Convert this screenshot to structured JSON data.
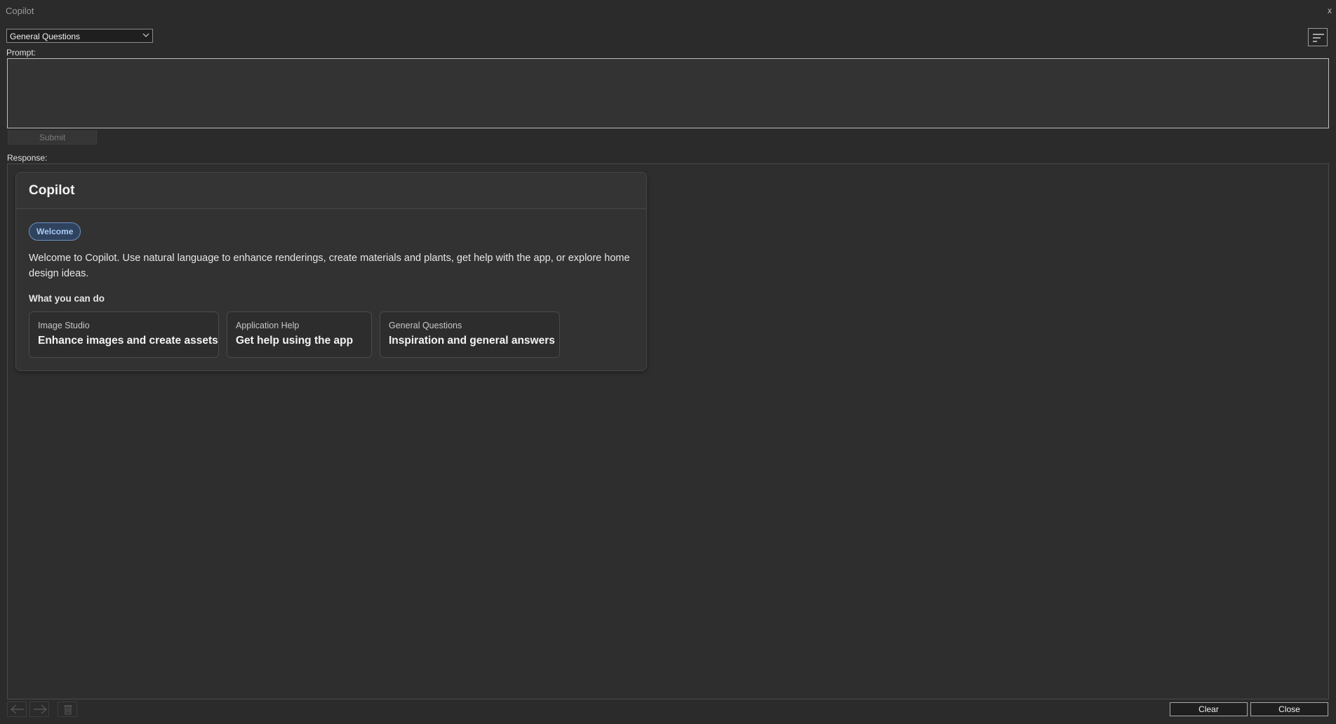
{
  "window": {
    "title": "Copilot",
    "close_glyph": "x"
  },
  "mode_select": {
    "selected": "General Questions",
    "icon": "chevron-down-icon"
  },
  "menu_icon": "sort-lines-icon",
  "prompt": {
    "label": "Prompt:",
    "value": "",
    "placeholder": ""
  },
  "submit_label": "Submit",
  "response_label": "Response:",
  "card": {
    "title": "Copilot",
    "badge": "Welcome",
    "intro": "Welcome to Copilot. Use natural language to enhance renderings, create materials and plants, get help with the app, or explore home design ideas.",
    "subhead": "What you can do",
    "features": [
      {
        "caption": "Image Studio",
        "title": "Enhance images and create assets"
      },
      {
        "caption": "Application Help",
        "title": "Get help using the app"
      },
      {
        "caption": "General Questions",
        "title": "Inspiration and general answers"
      }
    ]
  },
  "bottom": {
    "icons": [
      "arrow-left-icon",
      "arrow-right-icon",
      "trash-icon"
    ],
    "clear_label": "Clear",
    "close_label": "Close"
  },
  "colors": {
    "accent_badge": "#a9c9f5",
    "badge_bg": "#2f435f",
    "background": "#2b2b2b"
  }
}
